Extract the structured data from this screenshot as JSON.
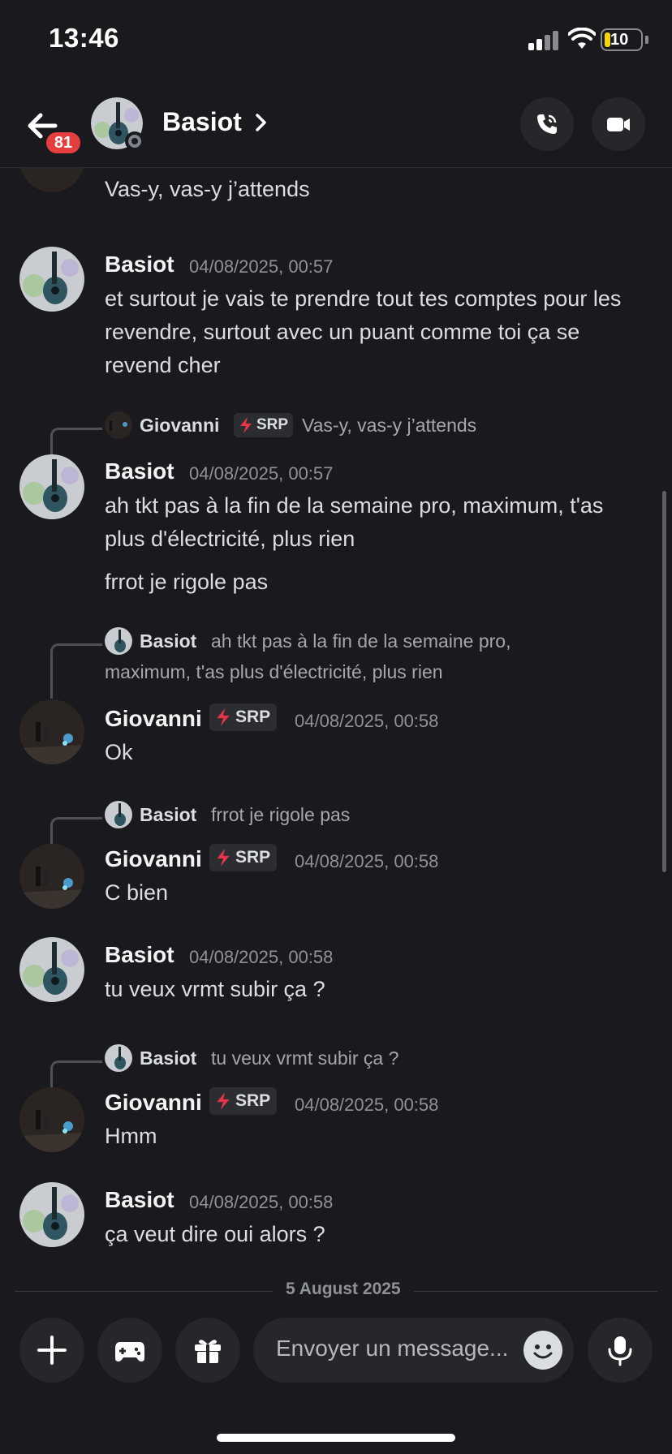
{
  "status_bar": {
    "time": "13:46",
    "battery": "10"
  },
  "header": {
    "name": "Basiot",
    "unread_count": "81"
  },
  "messages": [
    {
      "text": "Vas-y, vas-y j’attends"
    },
    {
      "author": "Basiot",
      "time": "04/08/2025, 00:57",
      "text": "et surtout je vais te prendre tout tes comptes pour les revendre, surtout avec un puant comme toi ça se revend cher"
    },
    {
      "reply": {
        "author": "Giovanni",
        "tag": "SRP",
        "text": "Vas-y, vas-y j’attends"
      },
      "author": "Basiot",
      "time": "04/08/2025, 00:57",
      "text": "ah tkt pas à la fin de la semaine pro, maximum, t'as plus d'électricité, plus rien",
      "text2": "frrot je rigole pas"
    },
    {
      "reply": {
        "author": "Basiot",
        "text": "ah tkt pas à la fin de la semaine pro,",
        "text_line2": "maximum, t'as plus d'électricité, plus rien"
      },
      "author": "Giovanni",
      "tag": "SRP",
      "time": "04/08/2025, 00:58",
      "text": "Ok"
    },
    {
      "reply": {
        "author": "Basiot",
        "text": "frrot je rigole pas"
      },
      "author": "Giovanni",
      "tag": "SRP",
      "time": "04/08/2025, 00:58",
      "text": "C bien"
    },
    {
      "author": "Basiot",
      "time": "04/08/2025, 00:58",
      "text": "tu veux vrmt subir ça ?"
    },
    {
      "reply": {
        "author": "Basiot",
        "text": "tu veux vrmt subir ça ?"
      },
      "author": "Giovanni",
      "tag": "SRP",
      "time": "04/08/2025, 00:58",
      "text": "Hmm"
    },
    {
      "author": "Basiot",
      "time": "04/08/2025, 00:58",
      "text": "ça veut dire oui alors ?"
    }
  ],
  "date_divider": "5 August 2025",
  "composer": {
    "placeholder": "Envoyer un message..."
  },
  "colors": {
    "background": "#1a1a1e",
    "badge": "#e53e3e",
    "bolt": "#e8334a",
    "surface": "#26272b"
  }
}
